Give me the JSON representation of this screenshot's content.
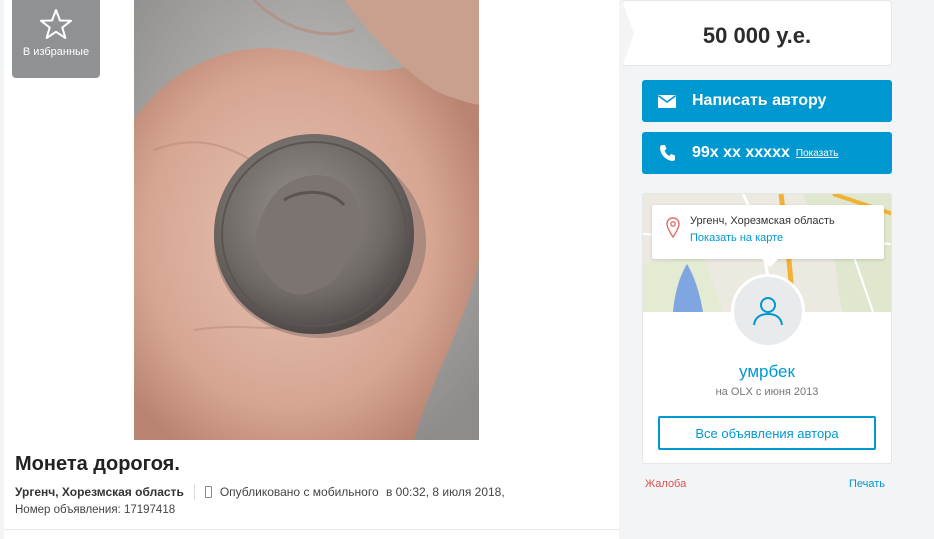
{
  "favorite": {
    "label": "В избранные",
    "icon": "star-icon"
  },
  "ad": {
    "title": "Монета дорогоя.",
    "city": "Ургенч, Хорезмская область",
    "published_prefix": "Опубликовано с мобильного",
    "published_time": "в 00:32, 8 июля 2018,",
    "number": "Номер объявления: 17197418"
  },
  "price": "50 000 у.е.",
  "actions": {
    "write_author": "Написать автору",
    "phone": "99x xx xxxxx",
    "show_phone": "Показать"
  },
  "map": {
    "location": "Ургенч, Хорезмская область",
    "show_on_map": "Показать на карте"
  },
  "seller": {
    "name": "умрбек",
    "since": "на OLX с июня 2013",
    "all_ads": "Все объявления автора"
  },
  "footer_links": {
    "complaint": "Жалоба",
    "print": "Печать"
  },
  "colors": {
    "accent": "#0098d0",
    "complaint": "#d9534f"
  }
}
